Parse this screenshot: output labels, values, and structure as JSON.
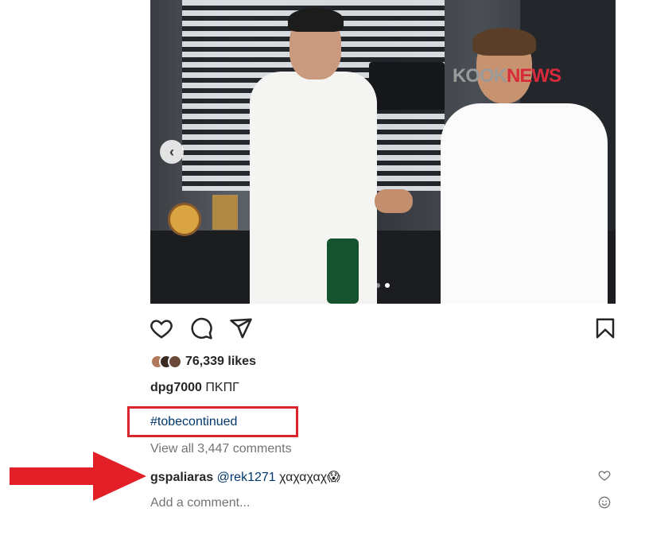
{
  "post": {
    "watermark_brand": "KOOK",
    "watermark_news": "NEWS",
    "carousel": {
      "current_index": 2,
      "total": 2
    }
  },
  "actions": {
    "like_icon": "heart-icon",
    "comment_icon": "comment-bubble-icon",
    "share_icon": "paper-plane-icon",
    "save_icon": "bookmark-icon"
  },
  "likes": {
    "count_label": "76,339 likes"
  },
  "caption": {
    "username": "dpg7000",
    "text": " ΠΚΠΓ"
  },
  "hashtag": {
    "text": "#tobecontinued",
    "highlight_color": "#d9252b"
  },
  "comments": {
    "view_all": "View all 3,447 comments",
    "items": [
      {
        "username": "gspaliaras",
        "mention": "@rek1271",
        "text": " χαχαχαχ😱"
      }
    ]
  },
  "composer": {
    "placeholder": "Add a comment..."
  },
  "annotation": {
    "arrow_color": "#e21f26"
  }
}
